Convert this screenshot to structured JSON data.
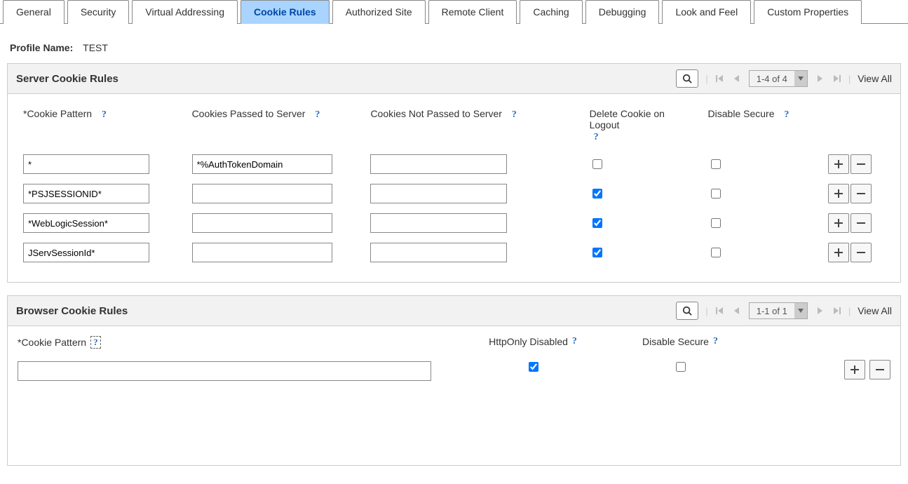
{
  "tabs": {
    "general": "General",
    "security": "Security",
    "virtual_addressing": "Virtual Addressing",
    "cookie_rules": "Cookie Rules",
    "authorized_site": "Authorized Site",
    "remote_client": "Remote Client",
    "caching": "Caching",
    "debugging": "Debugging",
    "look_and_feel": "Look and Feel",
    "custom_properties": "Custom Properties"
  },
  "profile": {
    "label": "Profile Name:",
    "value": "TEST"
  },
  "server_grid": {
    "title": "Server Cookie Rules",
    "pager": "1-4 of 4",
    "view_all": "View All",
    "headers": {
      "cookie_pattern": "*Cookie Pattern",
      "passed": "Cookies Passed to Server",
      "not_passed": "Cookies Not Passed to Server",
      "delete": "Delete Cookie on Logout",
      "disable": "Disable Secure"
    },
    "rows": [
      {
        "pattern": "*",
        "passed": "*%AuthTokenDomain",
        "not_passed": "",
        "delete": false,
        "disable": false
      },
      {
        "pattern": "*PSJSESSIONID*",
        "passed": "",
        "not_passed": "",
        "delete": true,
        "disable": false
      },
      {
        "pattern": "*WebLogicSession*",
        "passed": "",
        "not_passed": "",
        "delete": true,
        "disable": false
      },
      {
        "pattern": "JServSessionId*",
        "passed": "",
        "not_passed": "",
        "delete": true,
        "disable": false
      }
    ]
  },
  "browser_grid": {
    "title": "Browser Cookie Rules",
    "pager": "1-1 of 1",
    "view_all": "View All",
    "headers": {
      "cookie_pattern": "*Cookie Pattern",
      "httponly": "HttpOnly Disabled",
      "disable": "Disable Secure"
    },
    "row": {
      "pattern": "",
      "httponly": true,
      "disable": false
    }
  }
}
